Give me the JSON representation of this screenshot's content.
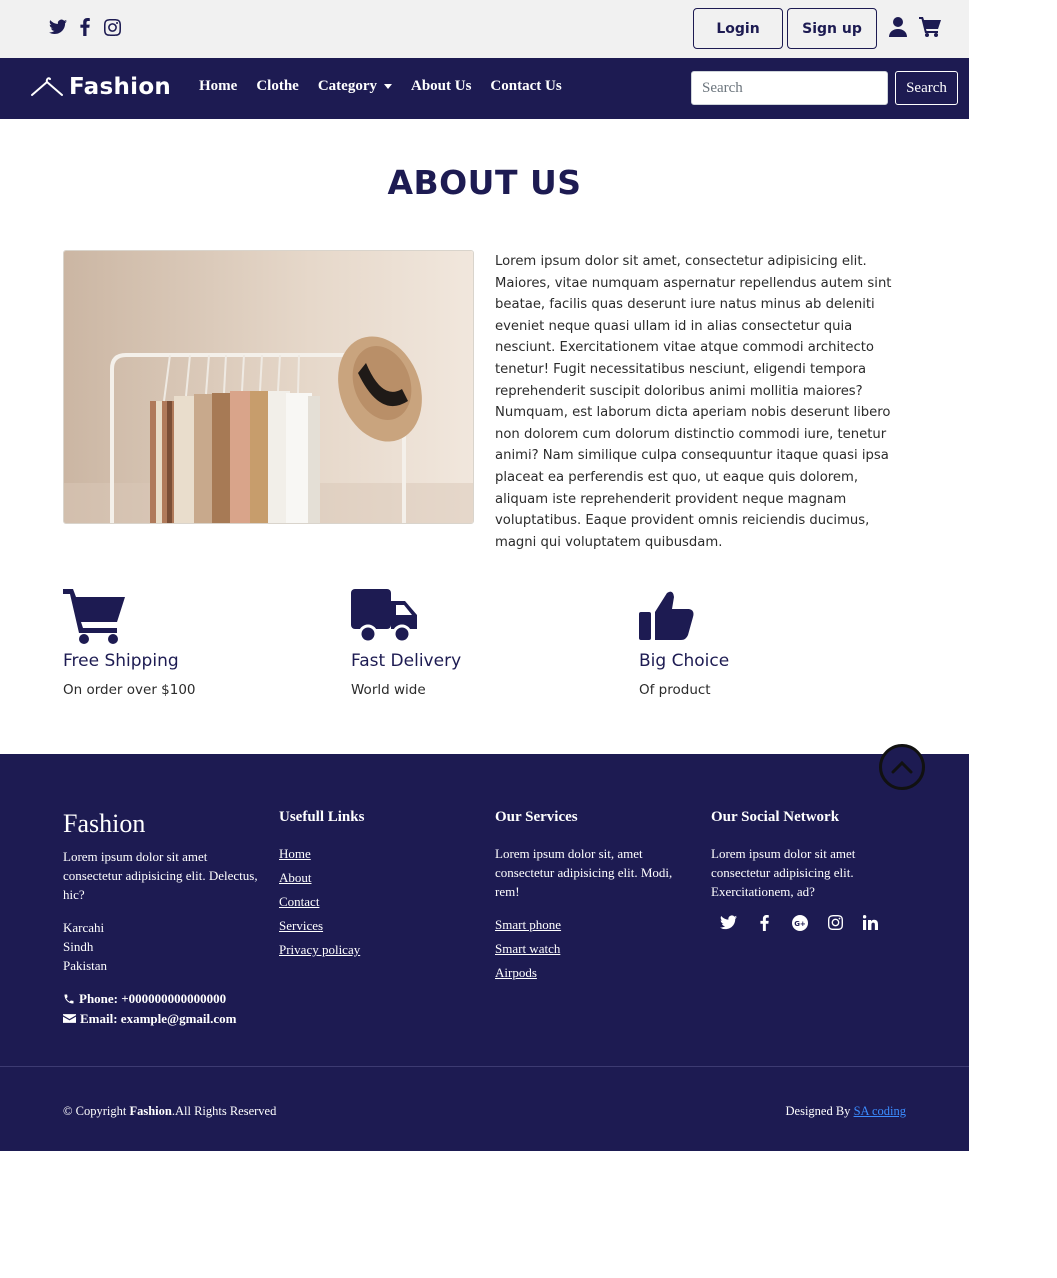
{
  "topbar": {
    "social_icons": [
      "twitter-icon",
      "facebook-icon",
      "instagram-icon"
    ],
    "login_label": "Login",
    "signup_label": "Sign up",
    "user_icon": "user-icon",
    "cart_icon": "cart-icon"
  },
  "navbar": {
    "brand": "Fashion",
    "links": [
      "Home",
      "Clothe",
      "Category",
      "About Us",
      "Contact Us"
    ],
    "search_placeholder": "Search",
    "search_button": "Search"
  },
  "about": {
    "title": "ABOUT US",
    "text": "Lorem ipsum dolor sit amet, consectetur adipisicing elit. Maiores, vitae numquam aspernatur repellendus autem sint beatae, facilis quas deserunt iure natus minus ab deleniti eveniet neque quasi ullam id in alias consectetur quia nesciunt. Exercitationem vitae atque commodi architecto tenetur! Fugit necessitatibus nesciunt, eligendi tempora reprehenderit suscipit doloribus animi mollitia maiores? Numquam, est laborum dicta aperiam nobis deserunt libero non dolorem cum dolorum distinctio commodi iure, tenetur animi? Nam similique culpa consequuntur itaque quasi ipsa placeat ea perferendis est quo, ut eaque quis dolorem, aliquam iste reprehenderit provident neque magnam voluptatibus. Eaque provident omnis reiciendis ducimus, magni qui voluptatem quibusdam."
  },
  "features": [
    {
      "icon": "cart-icon",
      "title": "Free Shipping",
      "subtitle": "On order over $100"
    },
    {
      "icon": "truck-icon",
      "title": "Fast Delivery",
      "subtitle": "World wide"
    },
    {
      "icon": "thumbs-up-icon",
      "title": "Big Choice",
      "subtitle": "Of product"
    }
  ],
  "footer": {
    "brand": "Fashion",
    "brand_text": "Lorem ipsum dolor sit amet consectetur adipisicing elit. Delectus, hic?",
    "address": [
      "Karcahi",
      "Sindh",
      "Pakistan"
    ],
    "phone": "Phone: +000000000000000",
    "email": "Email: example@gmail.com",
    "links_heading": "Usefull Links",
    "links": [
      "Home",
      "About",
      "Contact",
      "Services",
      "Privacy policay"
    ],
    "services_heading": "Our Services",
    "services_text": "Lorem ipsum dolor sit, amet consectetur adipisicing elit. Modi, rem!",
    "services": [
      "Smart phone",
      "Smart watch",
      "Airpods"
    ],
    "social_heading": "Our Social Network",
    "social_text": "Lorem ipsum dolor sit amet consectetur adipisicing elit. Exercitationem, ad?",
    "social_icons": [
      "twitter-icon",
      "facebook-icon",
      "google-plus-icon",
      "instagram-icon",
      "linkedin-icon"
    ],
    "copyright_prefix": "© Copyright ",
    "copyright_brand": "Fashion",
    "copyright_suffix": ".All Rights Reserved",
    "designed_by_prefix": "Designed By ",
    "designed_by_link": "SA coding"
  },
  "colors": {
    "primary": "#1d1b52",
    "topbar_bg": "#f1f1f1",
    "link_blue": "#3b8cff"
  }
}
